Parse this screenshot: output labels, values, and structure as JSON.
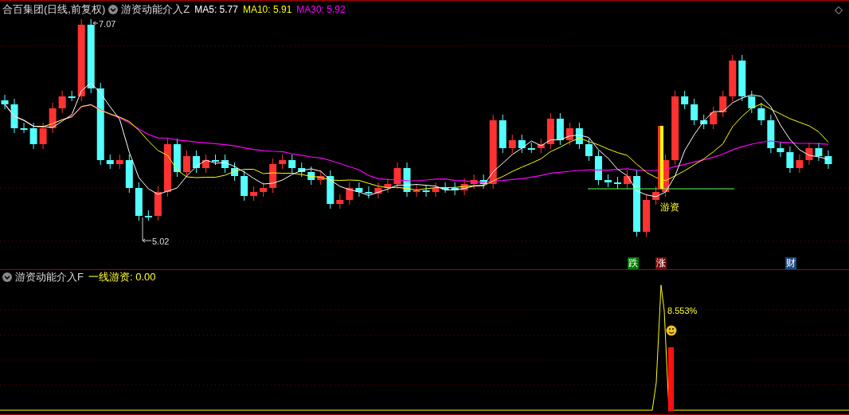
{
  "main_panel": {
    "title": "合百集团(日线,前复权)",
    "indicator": "游资动能介入Z",
    "ma_values": [
      {
        "label": "MA5: 5.77",
        "color": "#ffffff"
      },
      {
        "label": "MA10: 5.91",
        "color": "#ffff00"
      },
      {
        "label": "MA30: 5.92",
        "color": "#ff00ff"
      }
    ],
    "high_label": "7.07",
    "low_label": "5.02",
    "signal_label": "游资",
    "markers": [
      {
        "text": "跌",
        "color": "#007a00"
      },
      {
        "text": "涨",
        "color": "#7a0a0a"
      },
      {
        "text": "财",
        "color": "#1b4a80"
      }
    ]
  },
  "sub_panel": {
    "indicator": "游资动能介入F",
    "reading": "一线游资: 0.00",
    "peak_label": "8.553%"
  }
}
